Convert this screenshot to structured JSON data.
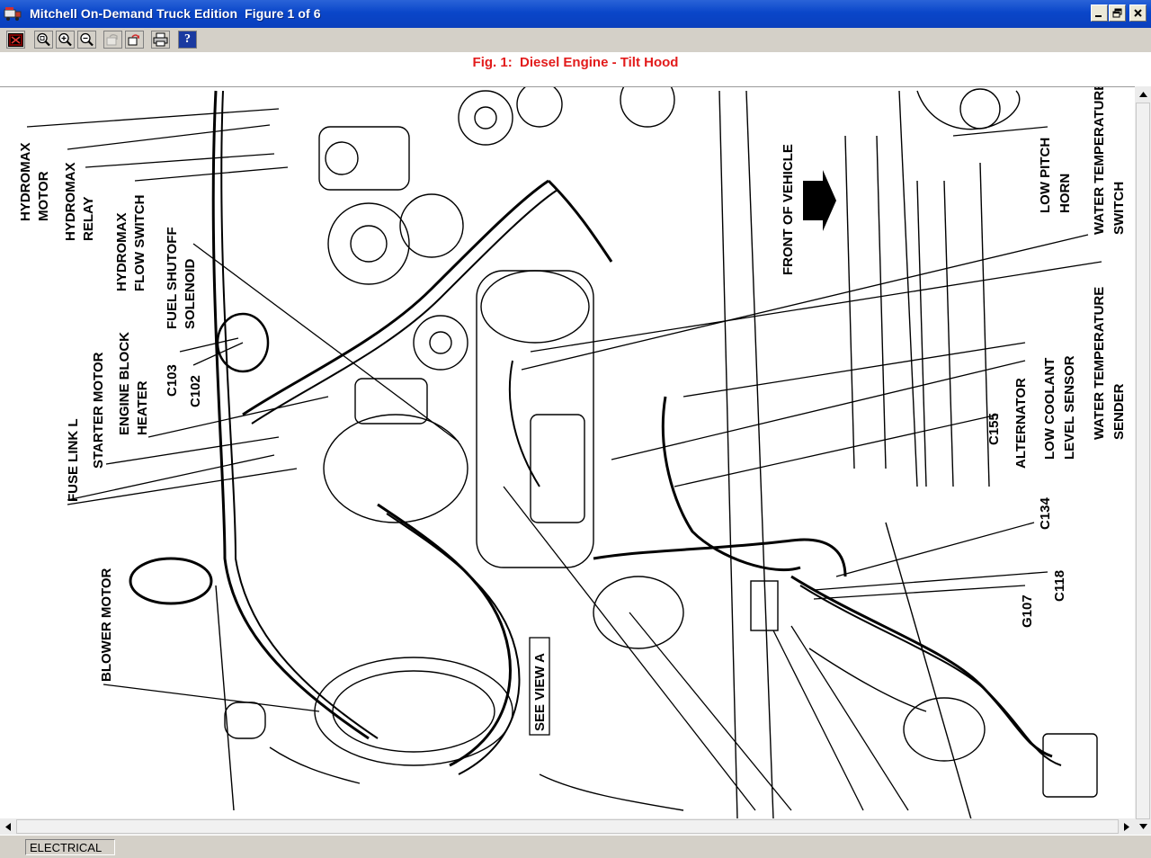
{
  "window": {
    "title": "Mitchell On-Demand Truck Edition  Figure 1 of 6"
  },
  "toolbar": {
    "buttons": [
      "exit-icon",
      "zoom-fit-icon",
      "zoom-in-icon",
      "zoom-out-icon",
      "rotate-left-icon",
      "rotate-right-icon",
      "print-icon",
      "help-icon"
    ],
    "help_label": "?"
  },
  "figure": {
    "caption": "Fig. 1:  Diesel Engine - Tilt Hood",
    "labels": {
      "hydromax_motor": [
        "HYDROMAX",
        "MOTOR"
      ],
      "hydromax_relay": [
        "HYDROMAX",
        "RELAY"
      ],
      "hydromax_flow_switch": [
        "HYDROMAX",
        "FLOW SWITCH"
      ],
      "fuel_shutoff_solenoid": [
        "FUEL SHUTOFF",
        "SOLENOID"
      ],
      "c103": "C103",
      "c102": "C102",
      "fuse_link_l": "FUSE LINK L",
      "starter_motor": "STARTER MOTOR",
      "engine_block_heater": [
        "ENGINE BLOCK",
        "HEATER"
      ],
      "blower_motor": "BLOWER MOTOR",
      "see_view_a": "SEE VIEW A",
      "front_of_vehicle": "FRONT OF VEHICLE",
      "low_pitch_horn": [
        "LOW PITCH",
        "HORN"
      ],
      "water_temperature_switch": [
        "WATER TEMPERATURE",
        "SWITCH"
      ],
      "water_temperature_sender": [
        "WATER TEMPERATURE",
        "SENDER"
      ],
      "c155": "C155",
      "alternator": "ALTERNATOR",
      "low_coolant_level_sensor": [
        "LOW COOLANT",
        "LEVEL SENSOR"
      ],
      "c134": "C134",
      "c118": "C118",
      "g107": "G107"
    }
  },
  "status": {
    "section": "ELECTRICAL"
  }
}
